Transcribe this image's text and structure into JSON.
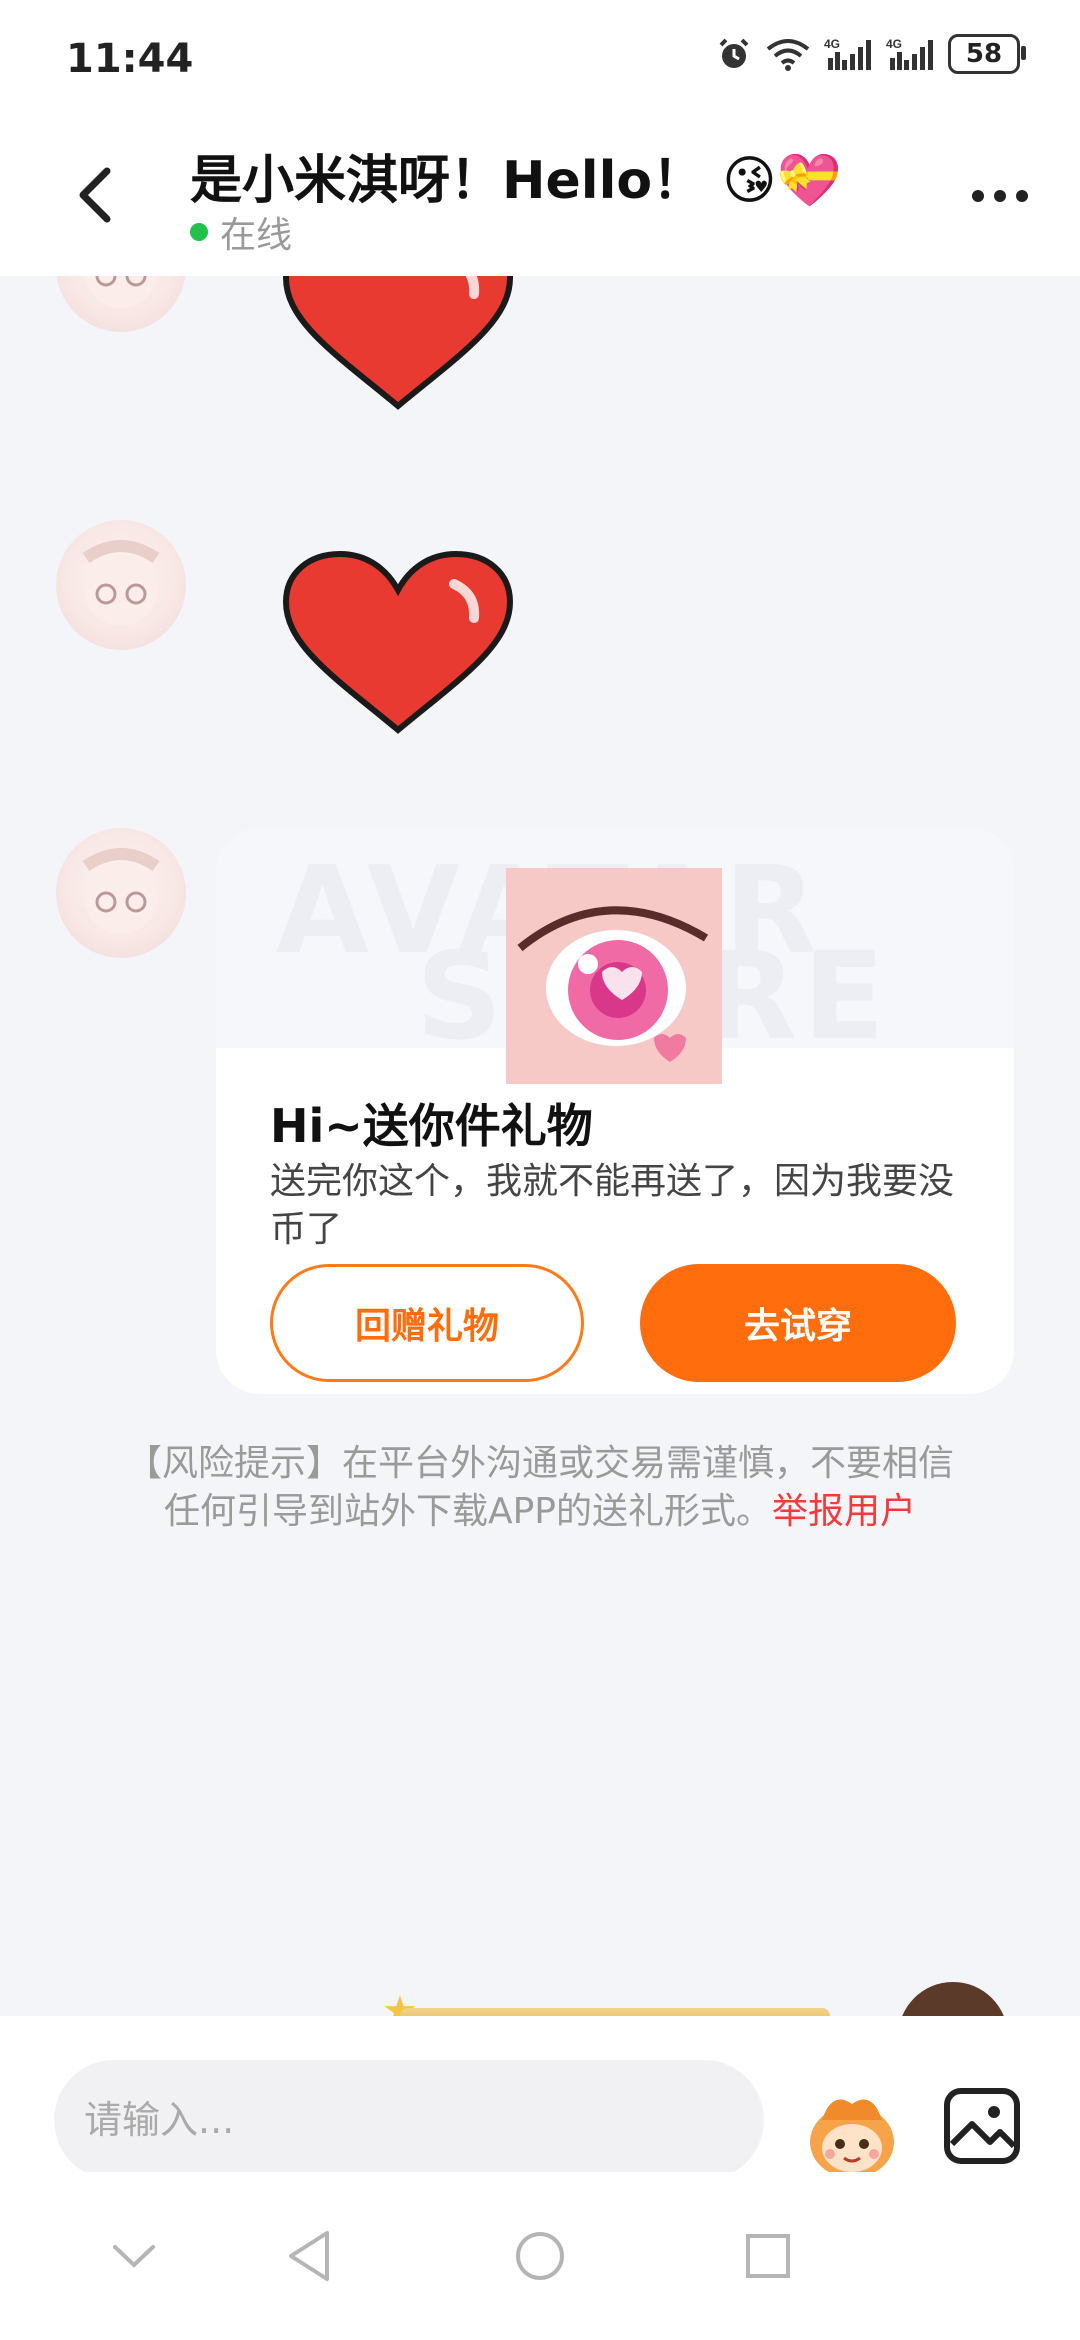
{
  "status_bar": {
    "time": "11:44",
    "battery": "58",
    "network_1": "4G",
    "network_2": "4G",
    "icons": [
      "alarm-icon",
      "wifi-icon",
      "signal-icon",
      "signal-icon",
      "battery-icon"
    ]
  },
  "header": {
    "title": "是小米淇呀！Hello！ 😘💝",
    "status": "在线"
  },
  "gift_card": {
    "watermark_line1": "AVATAR",
    "watermark_line2": "STORE",
    "title": "Hi~送你件礼物",
    "description": "送完你这个，我就不能再送了，因为我要没币了",
    "return_button": "回赠礼物",
    "try_button": "去试穿"
  },
  "risk_notice": {
    "text": "【风险提示】在平台外沟通或交易需谨慎，不要相信任何引导到站外下载APP的送礼形式。",
    "report_link": "举报用户"
  },
  "input_bar": {
    "placeholder": "请输入..."
  },
  "colors": {
    "accent": "#ff6d0d",
    "online": "#22c04c",
    "report": "#f03c3c",
    "heart": "#e83a30",
    "background": "#f4f5f9"
  }
}
